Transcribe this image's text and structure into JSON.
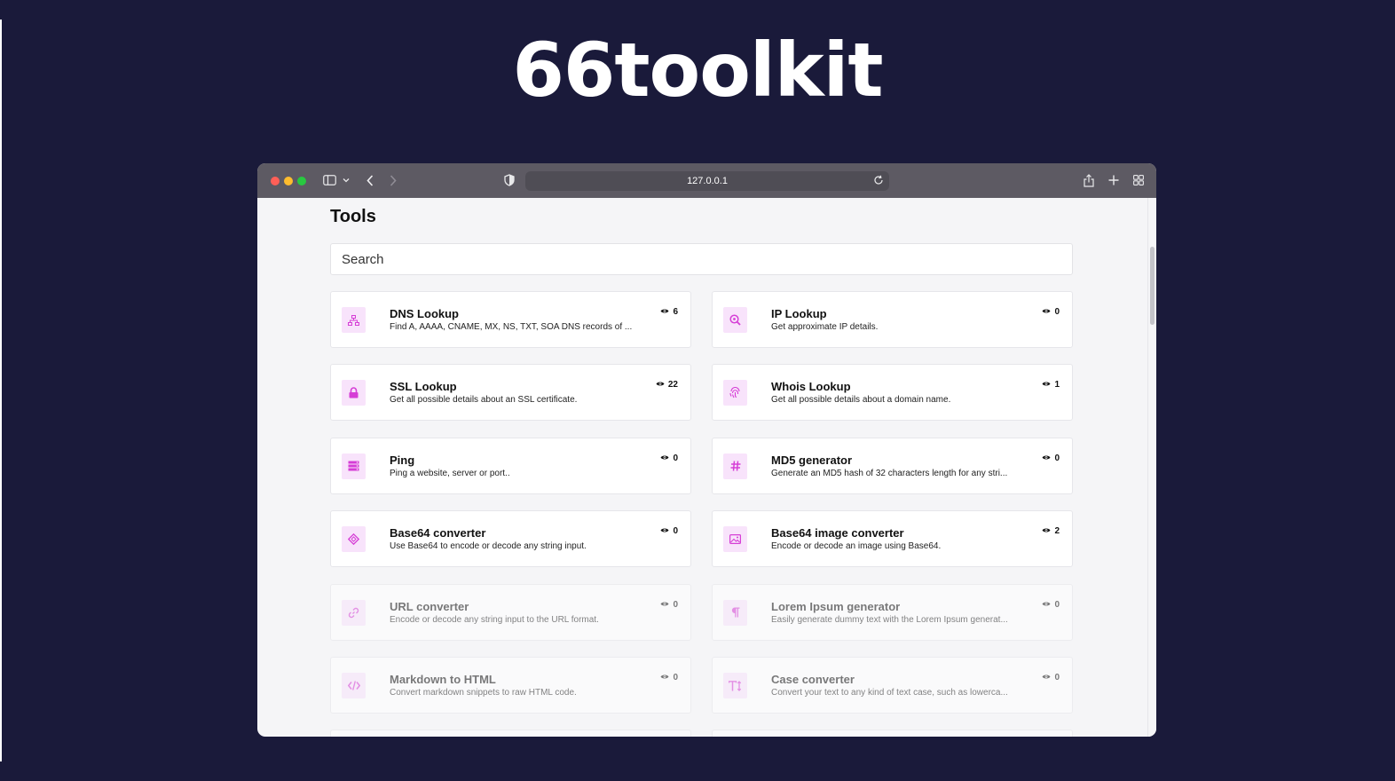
{
  "hero": {
    "title": "66toolkit"
  },
  "browser": {
    "url": "127.0.0.1",
    "colors": {
      "close": "#ff5f57",
      "minimize": "#febc2e",
      "zoom": "#28c840",
      "accent": "#d63ed6",
      "icon_bg": "#f8e3fb"
    }
  },
  "page": {
    "title": "Tools",
    "search_placeholder": "Search"
  },
  "tools": [
    {
      "name": "DNS Lookup",
      "description": "Find A, AAAA, CNAME, MX, NS, TXT, SOA DNS records of ...",
      "views": "6",
      "icon": "sitemap-icon"
    },
    {
      "name": "IP Lookup",
      "description": "Get approximate IP details.",
      "views": "0",
      "icon": "search-location-icon"
    },
    {
      "name": "SSL Lookup",
      "description": "Get all possible details about an SSL certificate.",
      "views": "22",
      "icon": "lock-icon"
    },
    {
      "name": "Whois Lookup",
      "description": "Get all possible details about a domain name.",
      "views": "1",
      "icon": "fingerprint-icon"
    },
    {
      "name": "Ping",
      "description": "Ping a website, server or port..",
      "views": "0",
      "icon": "server-icon"
    },
    {
      "name": "MD5 generator",
      "description": "Generate an MD5 hash of 32 characters length for any stri...",
      "views": "0",
      "icon": "hashtag-icon"
    },
    {
      "name": "Base64 converter",
      "description": "Use Base64 to encode or decode any string input.",
      "views": "0",
      "icon": "code-cube-icon"
    },
    {
      "name": "Base64 image converter",
      "description": "Encode or decode an image using Base64.",
      "views": "2",
      "icon": "image-icon"
    },
    {
      "name": "URL converter",
      "description": "Encode or decode any string input to the URL format.",
      "views": "0",
      "icon": "link-icon"
    },
    {
      "name": "Lorem Ipsum generator",
      "description": "Easily generate dummy text with the Lorem Ipsum generat...",
      "views": "0",
      "icon": "paragraph-icon"
    },
    {
      "name": "Markdown to HTML",
      "description": "Convert markdown snippets to raw HTML code.",
      "views": "0",
      "icon": "code-icon"
    },
    {
      "name": "Case converter",
      "description": "Convert your text to any kind of text case, such as lowerca...",
      "views": "0",
      "icon": "text-height-icon"
    }
  ]
}
